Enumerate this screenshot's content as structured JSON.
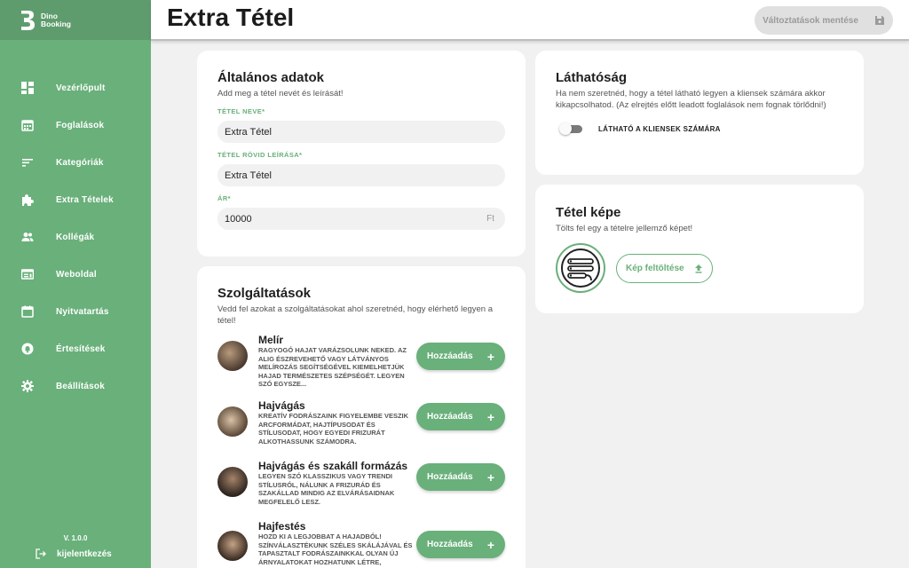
{
  "app": {
    "brand_line1": "Dino",
    "brand_line2": "Booking",
    "version": "V. 1.0.0",
    "logout_label": "kijelentkezés"
  },
  "sidebar": {
    "items": [
      {
        "label": "Vezérlőpult",
        "icon": "dashboard-icon"
      },
      {
        "label": "Foglalások",
        "icon": "calendar-icon"
      },
      {
        "label": "Kategóriák",
        "icon": "list-icon"
      },
      {
        "label": "Extra Tételek",
        "icon": "puzzle-icon"
      },
      {
        "label": "Kollégák",
        "icon": "people-icon"
      },
      {
        "label": "Weboldal",
        "icon": "web-icon"
      },
      {
        "label": "Nyitvatartás",
        "icon": "calendar-blank-icon"
      },
      {
        "label": "Értesítések",
        "icon": "bell-icon"
      },
      {
        "label": "Beállítások",
        "icon": "gear-icon"
      }
    ]
  },
  "header": {
    "title": "Extra Tétel",
    "save_label": "Változtatások mentése"
  },
  "general": {
    "title": "Általános adatok",
    "subtitle": "Add meg a tétel nevét és leírását!",
    "name_label": "TÉTEL NEVE*",
    "name_value": "Extra Tétel",
    "short_desc_label": "TÉTEL RÖVID LEÍRÁSA*",
    "short_desc_value": "Extra Tétel",
    "price_label": "ÁR*",
    "price_value": "10000",
    "price_unit": "Ft"
  },
  "services": {
    "title": "Szolgáltatások",
    "subtitle": "Vedd fel azokat a szolgáltatásokat ahol szeretnéd, hogy elérhető legyen a tétel!",
    "add_label": "Hozzáadás",
    "items": [
      {
        "name": "Melír",
        "desc": "RAGYOGÓ HAJAT VARÁZSOLUNK NEKED. AZ ALIG ÉSZREVEHETŐ VAGY LÁTVÁNYOS MELÍROZÁS SEGÍTSÉGÉVEL KIEMELHETJÜK HAJAD TERMÉSZETES SZÉPSÉGÉT. LEGYEN SZÓ EGYSZE..."
      },
      {
        "name": "Hajvágás",
        "desc": "KREATÍV FODRÁSZAINK FIGYELEMBE VESZIK ARCFORMÁDAT, HAJTÍPUSODAT ÉS STÍLUSODAT, HOGY EGYEDI FRIZURÁT ALKOTHASSUNK SZÁMODRA."
      },
      {
        "name": "Hajvágás és szakáll formázás",
        "desc": "LEGYEN SZÓ KLASSZIKUS VAGY TRENDI STÍLUSRÓL, NÁLUNK A FRIZURÁD ÉS SZAKÁLLAD MINDIG AZ ELVÁRÁSAIDNAK MEGFELELŐ LESZ."
      },
      {
        "name": "Hajfestés",
        "desc": "HOZD KI A LEGJOBBAT A HAJADBÓL! SZÍNVÁLASZTÉKUNK SZÉLES SKÁLÁJÁVAL ÉS TAPASZTALT FODRÁSZAINKKAL OLYAN ÚJ ÁRNYALATOKAT HOZHATUNK LÉTRE, AMELYEK ILLENEK"
      }
    ]
  },
  "visibility": {
    "title": "Láthatóság",
    "subtitle": "Ha nem szeretnéd, hogy a tétel látható legyen a kliensek számára akkor kikapcsolhatod. (Az elrejtés előtt leadott foglalások nem fognak törlődni!)",
    "toggle_label": "LÁTHATÓ A KLIENSEK SZÁMÁRA",
    "toggle_on": false
  },
  "image": {
    "title": "Tétel képe",
    "subtitle": "Tölts fel egy a tételre jellemző képet!",
    "upload_label": "Kép feltöltése"
  },
  "colors": {
    "accent": "#69b07a",
    "sidebar_bg": "#69b07a",
    "page_bg": "#f1f1f1"
  }
}
